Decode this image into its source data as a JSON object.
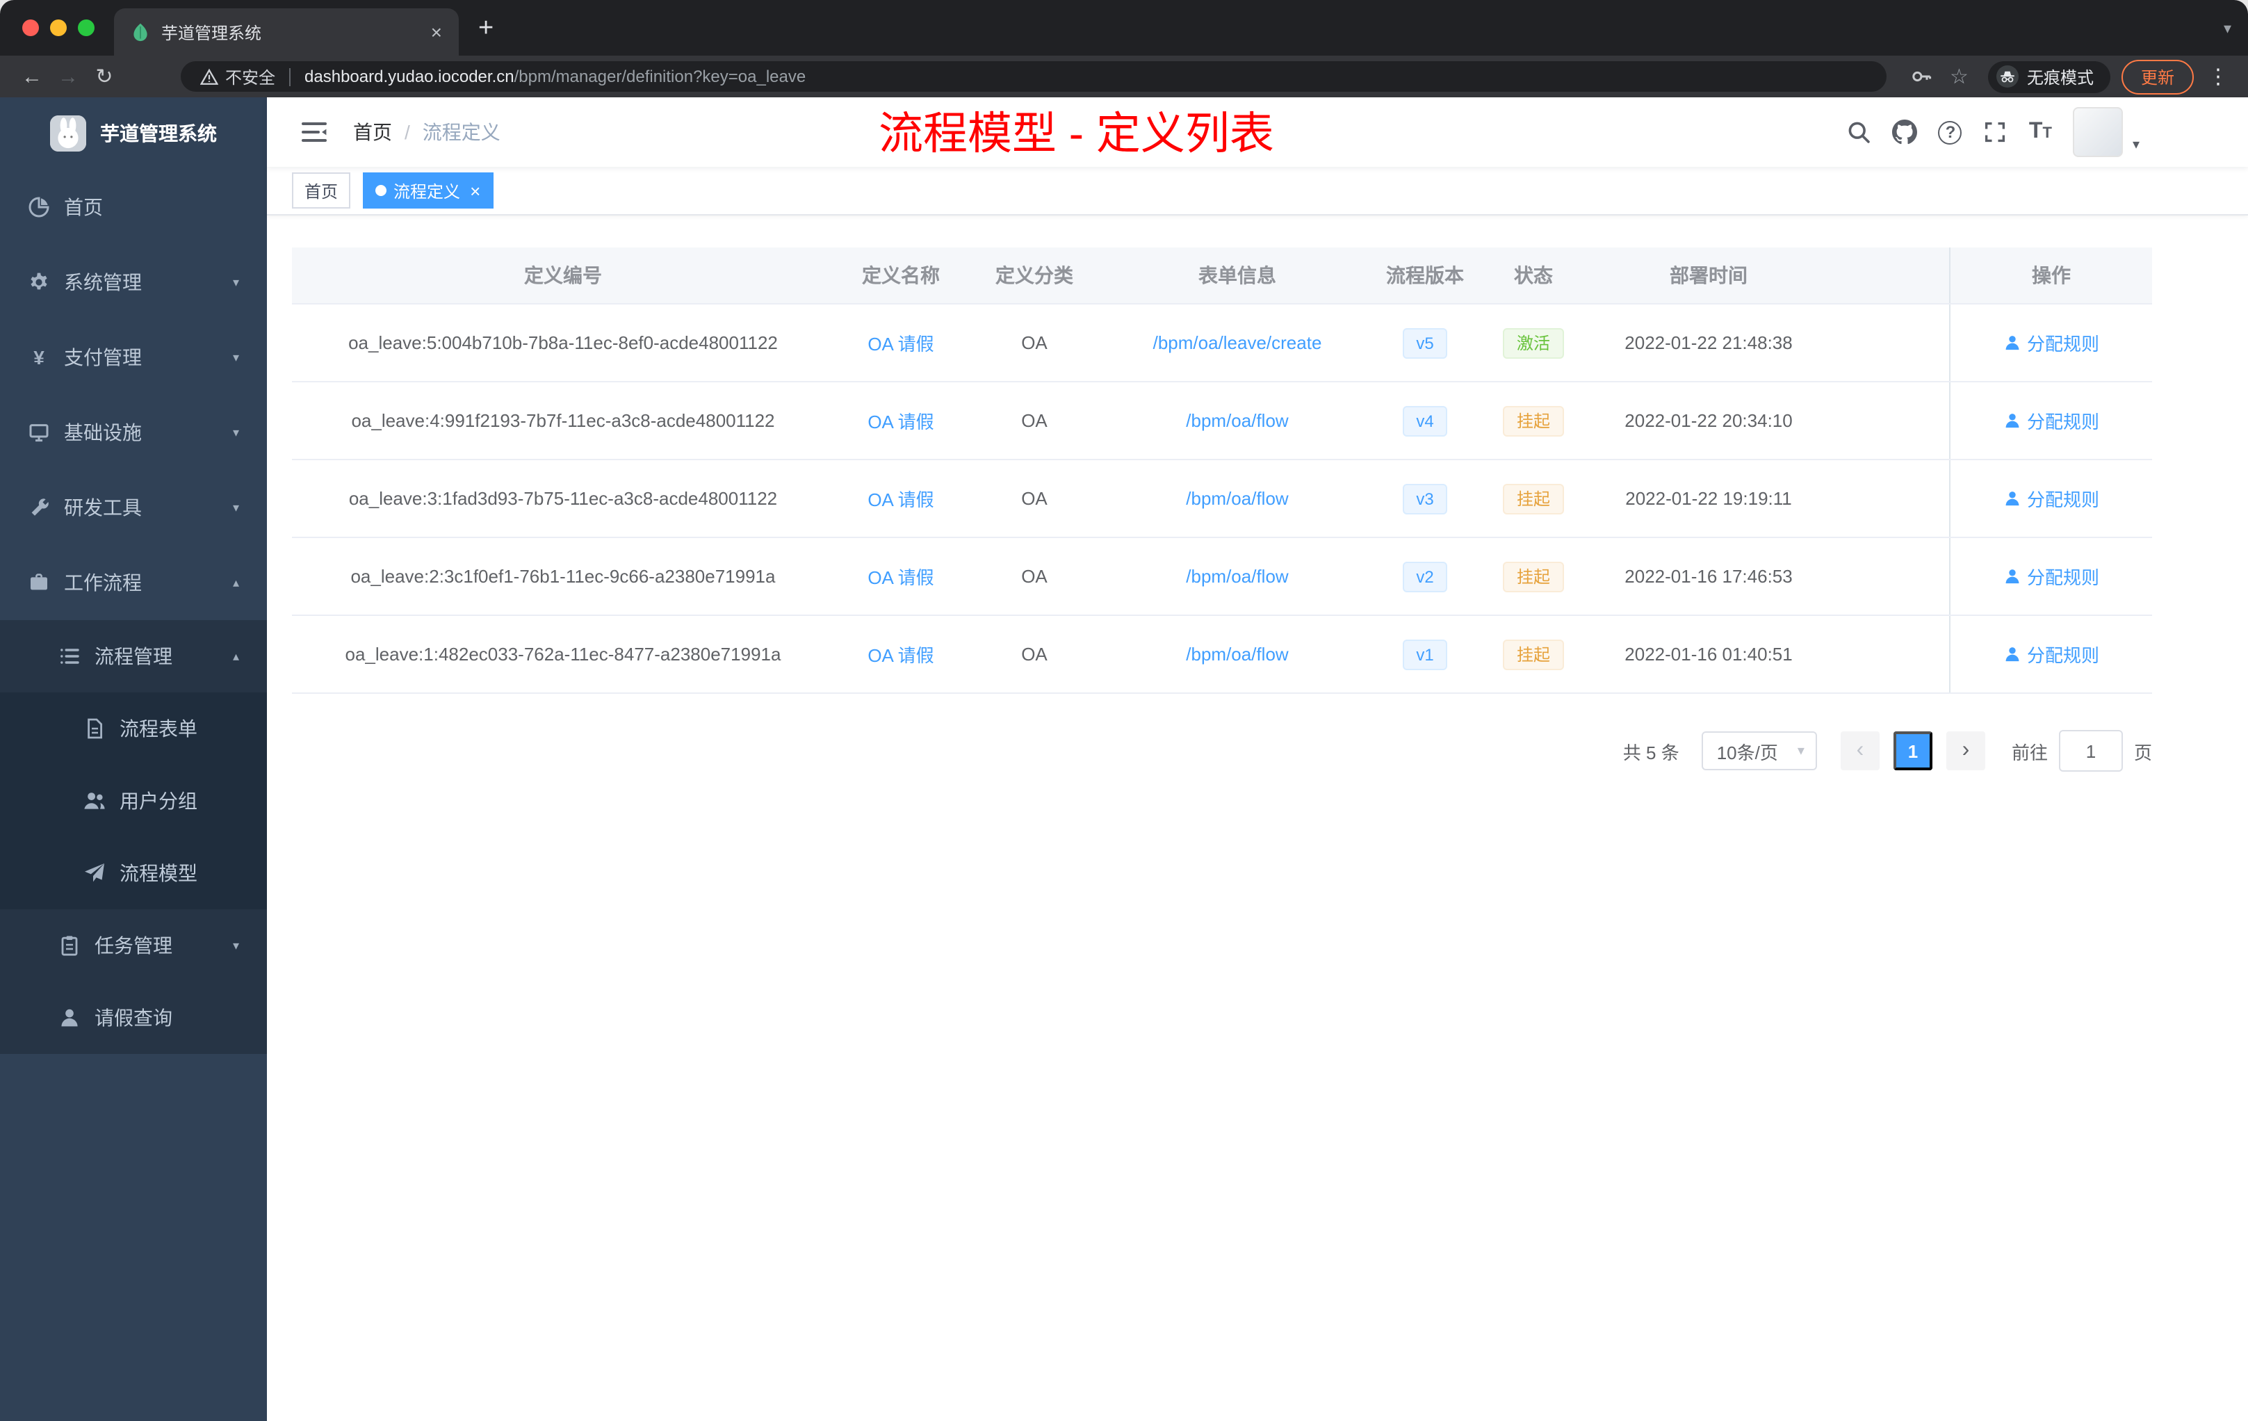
{
  "browser": {
    "tab": {
      "title": "芋道管理系统"
    },
    "security": "不安全",
    "url_host": "dashboard.yudao.iocoder.cn",
    "url_path": "/bpm/manager/definition?key=oa_leave",
    "incognito": "无痕模式",
    "update": "更新"
  },
  "sidebar": {
    "title": "芋道管理系统",
    "menu": [
      {
        "key": "home",
        "label": "首页",
        "level": 1,
        "icon": "dashboard",
        "chevron": ""
      },
      {
        "key": "system",
        "label": "系统管理",
        "level": 1,
        "icon": "gear",
        "chevron": "down"
      },
      {
        "key": "payment",
        "label": "支付管理",
        "level": 1,
        "icon": "yen",
        "chevron": "down"
      },
      {
        "key": "infra",
        "label": "基础设施",
        "level": 1,
        "icon": "infra",
        "chevron": "down"
      },
      {
        "key": "devtools",
        "label": "研发工具",
        "level": 1,
        "icon": "tools",
        "chevron": "down"
      },
      {
        "key": "workflow",
        "label": "工作流程",
        "level": 1,
        "icon": "workflow",
        "chevron": "up"
      },
      {
        "key": "process-manage",
        "label": "流程管理",
        "level": 2,
        "icon": "list",
        "chevron": "up"
      },
      {
        "key": "process-form",
        "label": "流程表单",
        "level": 3,
        "icon": "form",
        "chevron": ""
      },
      {
        "key": "user-group",
        "label": "用户分组",
        "level": 3,
        "icon": "users",
        "chevron": ""
      },
      {
        "key": "process-model",
        "label": "流程模型",
        "level": 3,
        "icon": "send",
        "chevron": ""
      },
      {
        "key": "task-manage",
        "label": "任务管理",
        "level": 2,
        "icon": "tasks",
        "chevron": "down"
      },
      {
        "key": "leave-query",
        "label": "请假查询",
        "level": 2,
        "icon": "user",
        "chevron": ""
      }
    ]
  },
  "navbar": {
    "breadcrumb": [
      "首页",
      "流程定义"
    ],
    "annotation": "流程模型 - 定义列表"
  },
  "tags": [
    {
      "label": "首页",
      "active": false,
      "closable": false
    },
    {
      "label": "流程定义",
      "active": true,
      "closable": true
    }
  ],
  "table": {
    "columns": [
      "定义编号",
      "定义名称",
      "定义分类",
      "表单信息",
      "流程版本",
      "状态",
      "部署时间",
      "操作"
    ],
    "rows": [
      {
        "id": "oa_leave:5:004b710b-7b8a-11ec-8ef0-acde48001122",
        "name": "OA 请假",
        "category": "OA",
        "form": "/bpm/oa/leave/create",
        "version": "v5",
        "status": "激活",
        "status_type": "success",
        "deploy_time": "2022-01-22 21:48:38",
        "action": "分配规则"
      },
      {
        "id": "oa_leave:4:991f2193-7b7f-11ec-a3c8-acde48001122",
        "name": "OA 请假",
        "category": "OA",
        "form": "/bpm/oa/flow",
        "version": "v4",
        "status": "挂起",
        "status_type": "warning",
        "deploy_time": "2022-01-22 20:34:10",
        "action": "分配规则"
      },
      {
        "id": "oa_leave:3:1fad3d93-7b75-11ec-a3c8-acde48001122",
        "name": "OA 请假",
        "category": "OA",
        "form": "/bpm/oa/flow",
        "version": "v3",
        "status": "挂起",
        "status_type": "warning",
        "deploy_time": "2022-01-22 19:19:11",
        "action": "分配规则"
      },
      {
        "id": "oa_leave:2:3c1f0ef1-76b1-11ec-9c66-a2380e71991a",
        "name": "OA 请假",
        "category": "OA",
        "form": "/bpm/oa/flow",
        "version": "v2",
        "status": "挂起",
        "status_type": "warning",
        "deploy_time": "2022-01-16 17:46:53",
        "action": "分配规则"
      },
      {
        "id": "oa_leave:1:482ec033-762a-11ec-8477-a2380e71991a",
        "name": "OA 请假",
        "category": "OA",
        "form": "/bpm/oa/flow",
        "version": "v1",
        "status": "挂起",
        "status_type": "warning",
        "deploy_time": "2022-01-16 01:40:51",
        "action": "分配规则"
      }
    ]
  },
  "pagination": {
    "total": "共 5 条",
    "page_size": "10条/页",
    "current_page": "1",
    "goto_label": "前往",
    "goto_value": "1",
    "goto_unit": "页"
  },
  "colors": {
    "accent": "#409eff",
    "success": "#67c23a",
    "warning": "#e6a23c",
    "annotation_red": "#ff0000",
    "sidebar_bg": "#304156",
    "update_orange": "#ff7a45"
  }
}
